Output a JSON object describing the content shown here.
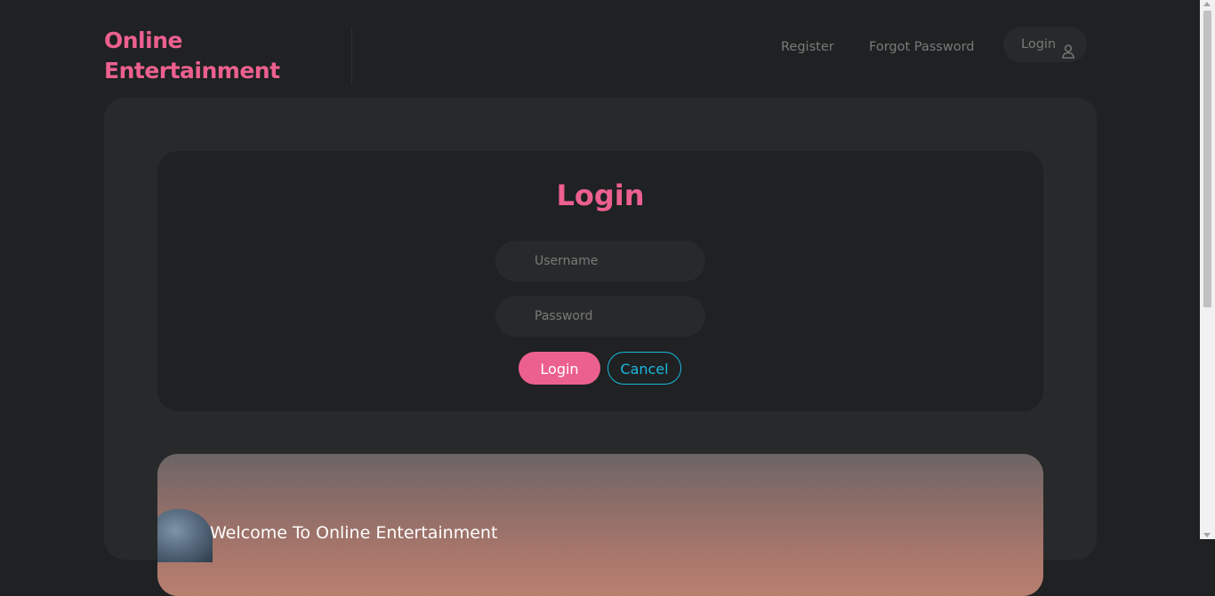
{
  "header": {
    "logo_line1": "Online",
    "logo_line2": "Entertainment",
    "nav": {
      "register": "Register",
      "forgot_password": "Forgot Password",
      "login": "Login",
      "login_icon": "user-icon"
    }
  },
  "login_form": {
    "title": "Login",
    "username_placeholder": "Username",
    "password_placeholder": "Password",
    "login_button": "Login",
    "cancel_button": "Cancel"
  },
  "banner": {
    "heading": "Welcome To Online Entertainment"
  },
  "colors": {
    "accent": "#ec6090",
    "secondary": "#1ab8e0",
    "background": "#1f2122",
    "panel": "#27292a"
  }
}
